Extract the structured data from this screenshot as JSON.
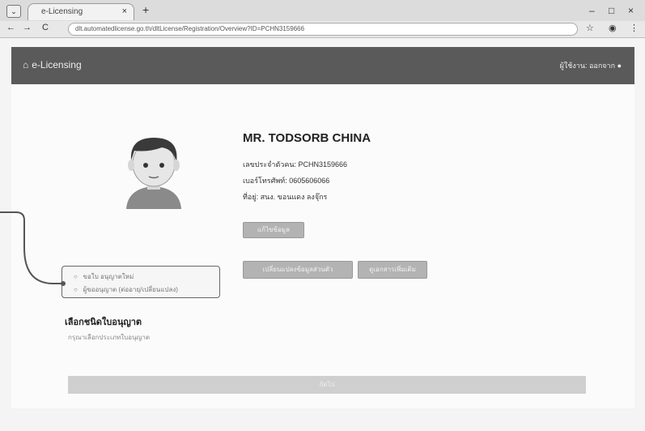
{
  "browser": {
    "tab_title": "e-Licensing",
    "tab_close": "×",
    "new_tab": "+",
    "tab_list": "⌄",
    "back": "←",
    "forward": "→",
    "reload": "C",
    "url": "dlt.automatedlicense.go.th/dltLicense/Registration/Overview?ID=PCHN3159666",
    "win_min": "–",
    "win_max": "□",
    "win_close": "×"
  },
  "navbar": {
    "brand": "e-Licensing",
    "user": "ผู้ใช้งาน: ออกจาก"
  },
  "profile": {
    "name": "MR. TODSORB CHINA",
    "passport": "เลขประจำตัวคน: PCHN3159666",
    "phone": "เบอร์โทรศัพท์: 0605606066",
    "address": "ที่อยู่: สนง. ขอนแดง ลงจุ๊กร",
    "edit_button": "แก้ไขข้อมูล",
    "change_button": "เปลี่ยนแปลงข้อมูลส่วนตัว",
    "docs_button": "ดูเอกสารเพิ่มเติม"
  },
  "sidebar": {
    "items": [
      {
        "icon": "○",
        "label": "ขอใบ อนุญาตใหม่"
      },
      {
        "icon": "○",
        "label": "ผู้ขออนุญาต (ต่ออายุ/เปลี่ยนแปลง)"
      }
    ]
  },
  "section": {
    "heading": "เลือกชนิดใบอนุญาต",
    "link": "กรุณาเลือกประเภทใบอนุญาต"
  },
  "footer": {
    "button": "ถัดไป"
  }
}
